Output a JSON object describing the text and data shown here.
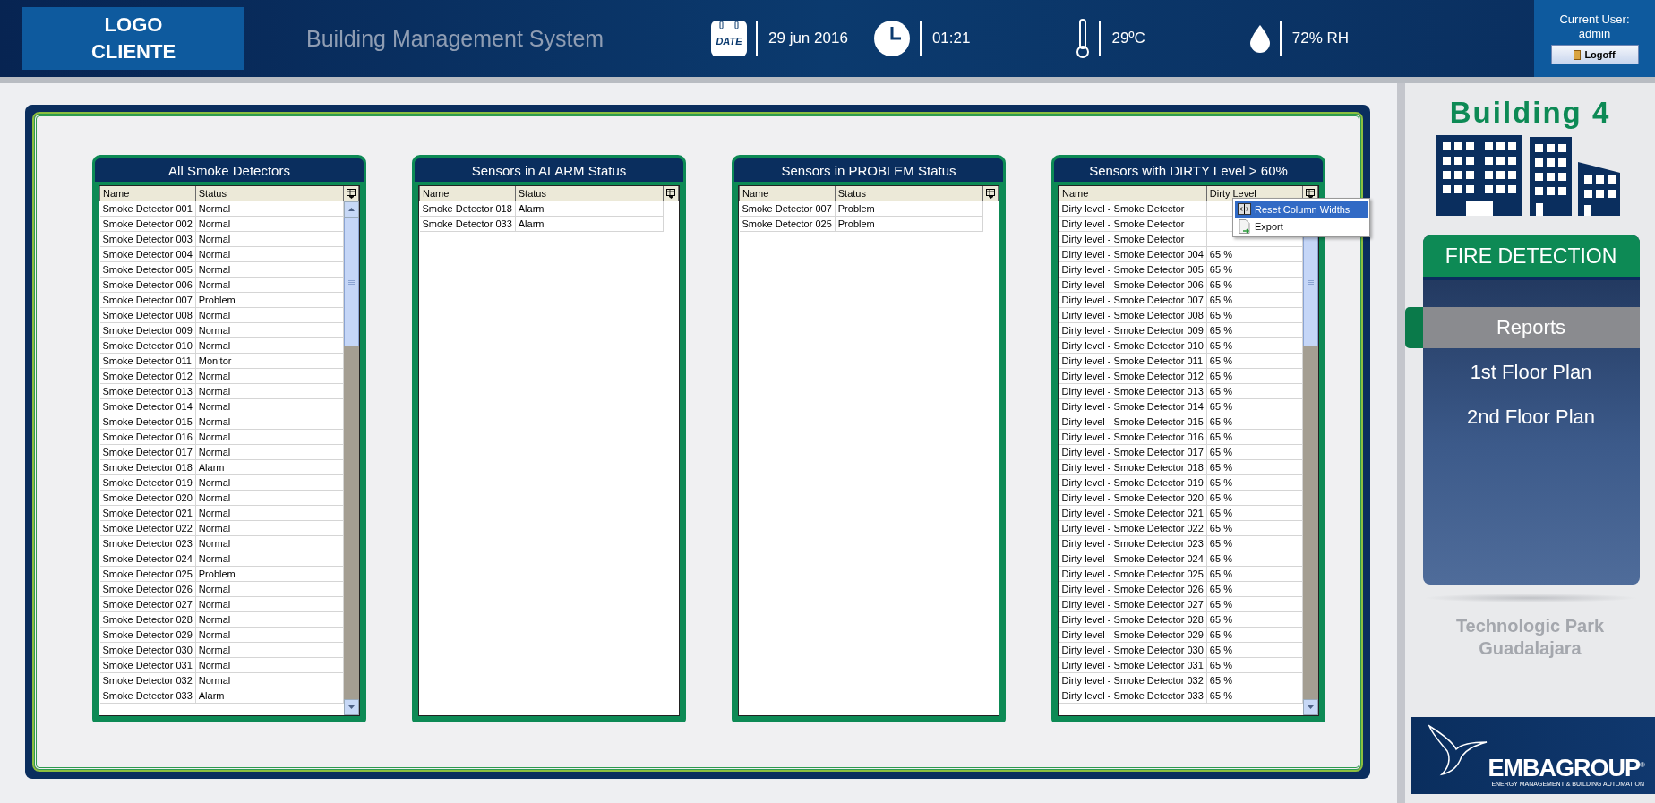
{
  "header": {
    "logo_lines": [
      "LOGO",
      "CLIENTE"
    ],
    "title": "Building Management System",
    "date_icon_label": "DATE",
    "date": "29 jun 2016",
    "time": "01:21",
    "temperature": "29ºC",
    "humidity": "72% RH",
    "user_label": "Current User:",
    "user": "admin",
    "logoff": "Logoff"
  },
  "tables": [
    {
      "title": "All Smoke Detectors",
      "kind": "scrolling",
      "columns": [
        "Name",
        "Status"
      ],
      "rows": [
        [
          "Smoke Detector 001",
          "Normal"
        ],
        [
          "Smoke Detector 002",
          "Normal"
        ],
        [
          "Smoke Detector 003",
          "Normal"
        ],
        [
          "Smoke Detector 004",
          "Normal"
        ],
        [
          "Smoke Detector 005",
          "Normal"
        ],
        [
          "Smoke Detector 006",
          "Normal"
        ],
        [
          "Smoke Detector 007",
          "Problem"
        ],
        [
          "Smoke Detector 008",
          "Normal"
        ],
        [
          "Smoke Detector 009",
          "Normal"
        ],
        [
          "Smoke Detector 010",
          "Normal"
        ],
        [
          "Smoke Detector 011",
          "Monitor"
        ],
        [
          "Smoke Detector 012",
          "Normal"
        ],
        [
          "Smoke Detector 013",
          "Normal"
        ],
        [
          "Smoke Detector 014",
          "Normal"
        ],
        [
          "Smoke Detector 015",
          "Normal"
        ],
        [
          "Smoke Detector 016",
          "Normal"
        ],
        [
          "Smoke Detector 017",
          "Normal"
        ],
        [
          "Smoke Detector 018",
          "Alarm"
        ],
        [
          "Smoke Detector 019",
          "Normal"
        ],
        [
          "Smoke Detector 020",
          "Normal"
        ],
        [
          "Smoke Detector 021",
          "Normal"
        ],
        [
          "Smoke Detector 022",
          "Normal"
        ],
        [
          "Smoke Detector 023",
          "Normal"
        ],
        [
          "Smoke Detector 024",
          "Normal"
        ],
        [
          "Smoke Detector 025",
          "Problem"
        ],
        [
          "Smoke Detector 026",
          "Normal"
        ],
        [
          "Smoke Detector 027",
          "Normal"
        ],
        [
          "Smoke Detector 028",
          "Normal"
        ],
        [
          "Smoke Detector 029",
          "Normal"
        ],
        [
          "Smoke Detector 030",
          "Normal"
        ],
        [
          "Smoke Detector 031",
          "Normal"
        ],
        [
          "Smoke Detector 032",
          "Normal"
        ],
        [
          "Smoke Detector 033",
          "Alarm"
        ]
      ]
    },
    {
      "title": "Sensors in ALARM Status",
      "kind": "plain",
      "columns": [
        "Name",
        "Status"
      ],
      "rows": [
        [
          "Smoke Detector 018",
          "Alarm"
        ],
        [
          "Smoke Detector 033",
          "Alarm"
        ]
      ]
    },
    {
      "title": "Sensors in PROBLEM Status",
      "kind": "plain",
      "columns": [
        "Name",
        "Status"
      ],
      "rows": [
        [
          "Smoke Detector 007",
          "Problem"
        ],
        [
          "Smoke Detector 025",
          "Problem"
        ]
      ]
    },
    {
      "title": "Sensors with DIRTY Level >  60%",
      "kind": "scrolling",
      "columns": [
        "Name",
        "Dirty Level"
      ],
      "rows": [
        [
          "Dirty level - Smoke Detector"
        ],
        [
          "Dirty level - Smoke Detector"
        ],
        [
          "Dirty level - Smoke Detector"
        ],
        [
          "Dirty level - Smoke Detector 004",
          "65 %"
        ],
        [
          "Dirty level - Smoke Detector 005",
          "65 %"
        ],
        [
          "Dirty level - Smoke Detector 006",
          "65 %"
        ],
        [
          "Dirty level - Smoke Detector 007",
          "65 %"
        ],
        [
          "Dirty level - Smoke Detector 008",
          "65 %"
        ],
        [
          "Dirty level - Smoke Detector 009",
          "65 %"
        ],
        [
          "Dirty level - Smoke Detector 010",
          "65 %"
        ],
        [
          "Dirty level - Smoke Detector 011",
          "65 %"
        ],
        [
          "Dirty level - Smoke Detector 012",
          "65 %"
        ],
        [
          "Dirty level - Smoke Detector 013",
          "65 %"
        ],
        [
          "Dirty level - Smoke Detector 014",
          "65 %"
        ],
        [
          "Dirty level - Smoke Detector 015",
          "65 %"
        ],
        [
          "Dirty level - Smoke Detector 016",
          "65 %"
        ],
        [
          "Dirty level - Smoke Detector 017",
          "65 %"
        ],
        [
          "Dirty level - Smoke Detector 018",
          "65 %"
        ],
        [
          "Dirty level - Smoke Detector 019",
          "65 %"
        ],
        [
          "Dirty level - Smoke Detector 020",
          "65 %"
        ],
        [
          "Dirty level - Smoke Detector 021",
          "65 %"
        ],
        [
          "Dirty level - Smoke Detector 022",
          "65 %"
        ],
        [
          "Dirty level - Smoke Detector 023",
          "65 %"
        ],
        [
          "Dirty level - Smoke Detector 024",
          "65 %"
        ],
        [
          "Dirty level - Smoke Detector 025",
          "65 %"
        ],
        [
          "Dirty level - Smoke Detector 026",
          "65 %"
        ],
        [
          "Dirty level - Smoke Detector 027",
          "65 %"
        ],
        [
          "Dirty level - Smoke Detector 028",
          "65 %"
        ],
        [
          "Dirty level - Smoke Detector 029",
          "65 %"
        ],
        [
          "Dirty level - Smoke Detector 030",
          "65 %"
        ],
        [
          "Dirty level - Smoke Detector 031",
          "65 %"
        ],
        [
          "Dirty level - Smoke Detector 032",
          "65 %"
        ],
        [
          "Dirty level - Smoke Detector 033",
          "65 %"
        ]
      ],
      "context_menu": [
        {
          "label": "Reset Column Widths",
          "kind": "resize",
          "selected": true
        },
        {
          "label": "Export",
          "kind": "export",
          "selected": false
        }
      ]
    }
  ],
  "sidebar": {
    "building": "Building 4",
    "section": "FIRE DETECTION",
    "items": [
      {
        "label": "Reports",
        "selected": true
      },
      {
        "label": "1st Floor Plan",
        "selected": false
      },
      {
        "label": "2nd Floor Plan",
        "selected": false
      }
    ],
    "location": "Technologic Park Guadalajara",
    "brand": "EMBAGROUP",
    "brand_mark": "®",
    "tagline": "ENERGY MANAGEMENT & BUILDING AUTOMATION"
  }
}
